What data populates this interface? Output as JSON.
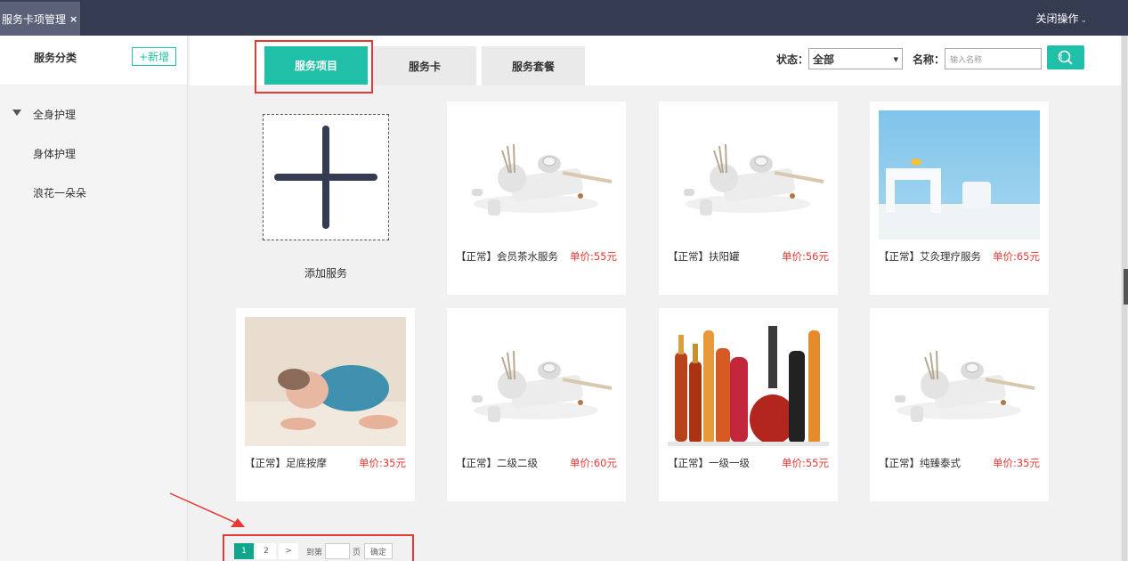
{
  "topbar": {
    "tab_label": "服务卡项管理",
    "tab_close": "×",
    "close_ops": "关闭操作",
    "caret": "⌄"
  },
  "sidebar": {
    "title": "服务分类",
    "add_label": "+新增",
    "items": [
      {
        "label": "全身护理",
        "expanded": true
      },
      {
        "label": "身体护理"
      },
      {
        "label": "浪花一朵朵"
      }
    ]
  },
  "tabs": [
    {
      "label": "服务项目",
      "active": true
    },
    {
      "label": "服务卡"
    },
    {
      "label": "服务套餐"
    }
  ],
  "filters": {
    "status_label": "状态：",
    "status_value": "全部",
    "name_label": "名称：",
    "name_placeholder": "输入名称"
  },
  "add_service_label": "添加服务",
  "cards": [
    {
      "name": "【正常】会员茶水服务",
      "price": "单价:55元",
      "image": "spa-kit"
    },
    {
      "name": "【正常】扶阳罐",
      "price": "单价:56元",
      "image": "spa-kit"
    },
    {
      "name": "【正常】艾灸理疗服务",
      "price": "单价:65元",
      "image": "blue-room"
    },
    {
      "name": "【正常】足底按摩",
      "price": "单价:35元",
      "image": "baby"
    },
    {
      "name": "【正常】二级二级",
      "price": "单价:60元",
      "image": "spa-kit"
    },
    {
      "name": "【正常】一级一级",
      "price": "单价:55元",
      "image": "bottles"
    },
    {
      "name": "【正常】纯臻泰式",
      "price": "单价:35元",
      "image": "spa-kit"
    }
  ],
  "pager": {
    "pages": [
      "1",
      "2"
    ],
    "next": ">",
    "goto_label": "到第",
    "page_unit": "页",
    "confirm": "确定",
    "current": 1
  },
  "colors": {
    "accent": "#1fbfa8",
    "topbar": "#353c52",
    "price": "#e53935",
    "highlight": "#e53935"
  }
}
